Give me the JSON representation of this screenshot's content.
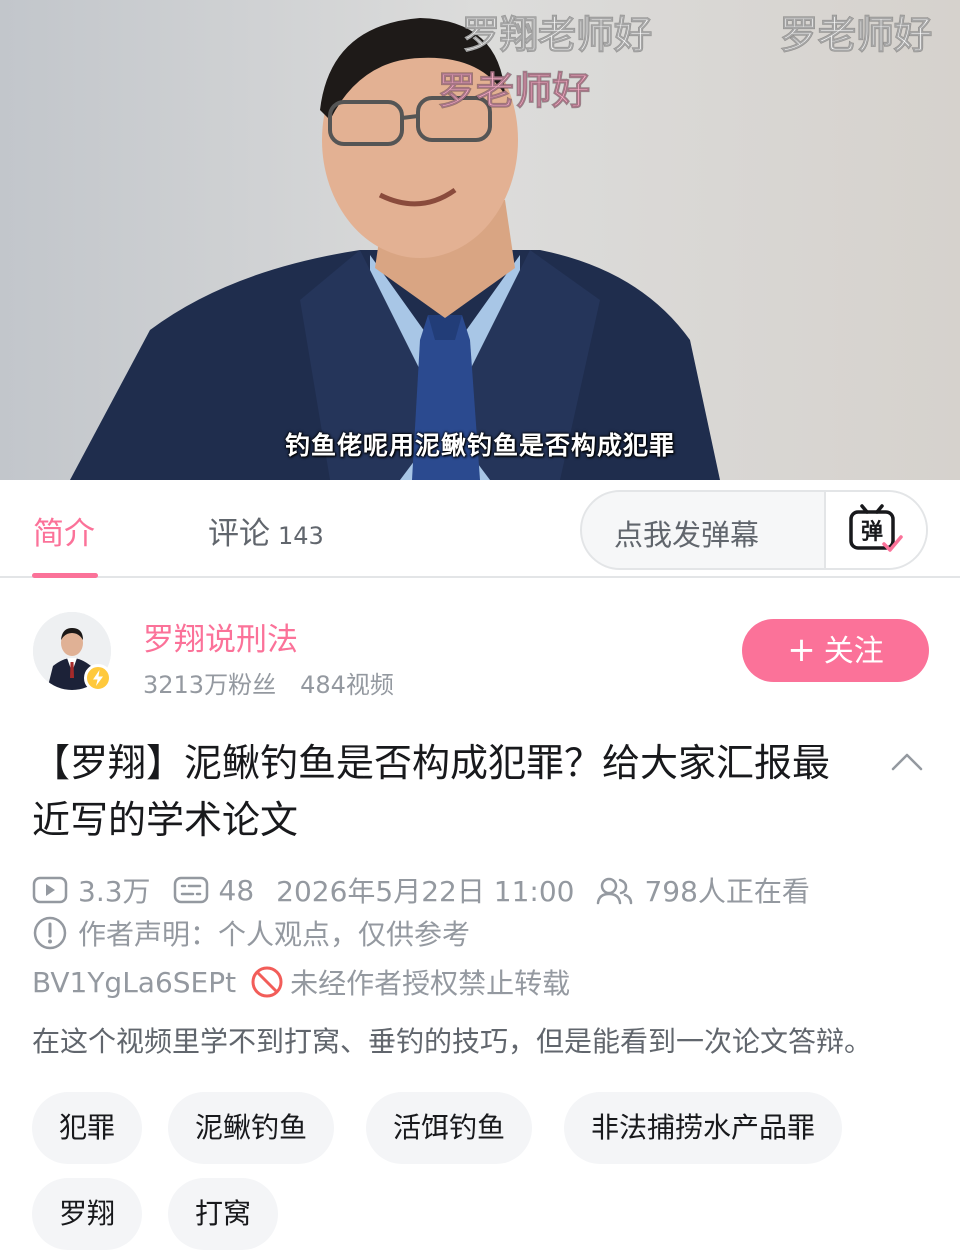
{
  "player": {
    "danmaku": [
      {
        "text": "罗翔老师好",
        "color": "white"
      },
      {
        "text": "罗老师好",
        "color": "white"
      },
      {
        "text": "罗老师好",
        "color": "pink"
      }
    ],
    "subtitle": "钓鱼佬呢用泥鳅钓鱼是否构成犯罪"
  },
  "tabs": {
    "intro_label": "简介",
    "comments_label": "评论",
    "comments_count": "143",
    "danmaku_placeholder": "点我发弹幕",
    "danmaku_icon_text": "弹"
  },
  "uploader": {
    "name": "罗翔说刑法",
    "followers": "3213万粉丝",
    "videos": "484视频",
    "follow_label": "关注",
    "follow_plus": "+"
  },
  "video": {
    "title": "【罗翔】泥鳅钓鱼是否构成犯罪？给大家汇报最近写的学术论文",
    "views": "3.3万",
    "danmaku_count": "48",
    "publish_time": "2026年5月22日 11:00",
    "watching_now": "798人正在看",
    "author_statement": "作者声明：个人观点，仅供参考",
    "bvid": "BV1YgLa6SEPt",
    "repost_notice": "未经作者授权禁止转载",
    "description": "在这个视频里学不到打窝、垂钓的技巧，但是能看到一次论文答辩。"
  },
  "tags": [
    "犯罪",
    "泥鳅钓鱼",
    "活饵钓鱼",
    "非法捕捞水产品罪",
    "罗翔",
    "打窝"
  ],
  "colors": {
    "accent": "#fb7299",
    "text_primary": "#18191c",
    "text_secondary": "#61666d",
    "text_muted": "#9499a0",
    "tag_bg": "#f4f5f7",
    "badge": "#ffc93c",
    "warning_red": "#f25d59"
  }
}
